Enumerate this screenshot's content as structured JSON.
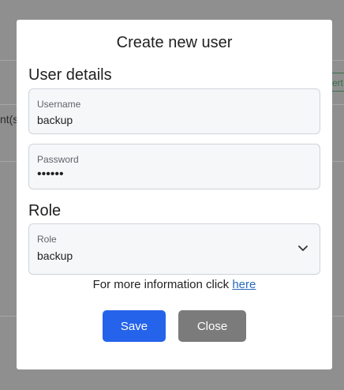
{
  "background": {
    "left_fragment": "nt(s)",
    "right_fragment": "ert"
  },
  "modal": {
    "title": "Create new user",
    "user_details_heading": "User details",
    "username": {
      "label": "Username",
      "value": "backup"
    },
    "password": {
      "label": "Password",
      "value": "••••••"
    },
    "role_heading": "Role",
    "role": {
      "label": "Role",
      "value": "backup"
    },
    "info": {
      "text": "For more information click ",
      "link": "here"
    },
    "buttons": {
      "save": "Save",
      "close": "Close"
    }
  },
  "colors": {
    "primary": "#2563eb",
    "secondary": "#7b7b7b",
    "link": "#2a6bbd",
    "backdrop": "#8f8f8f"
  }
}
